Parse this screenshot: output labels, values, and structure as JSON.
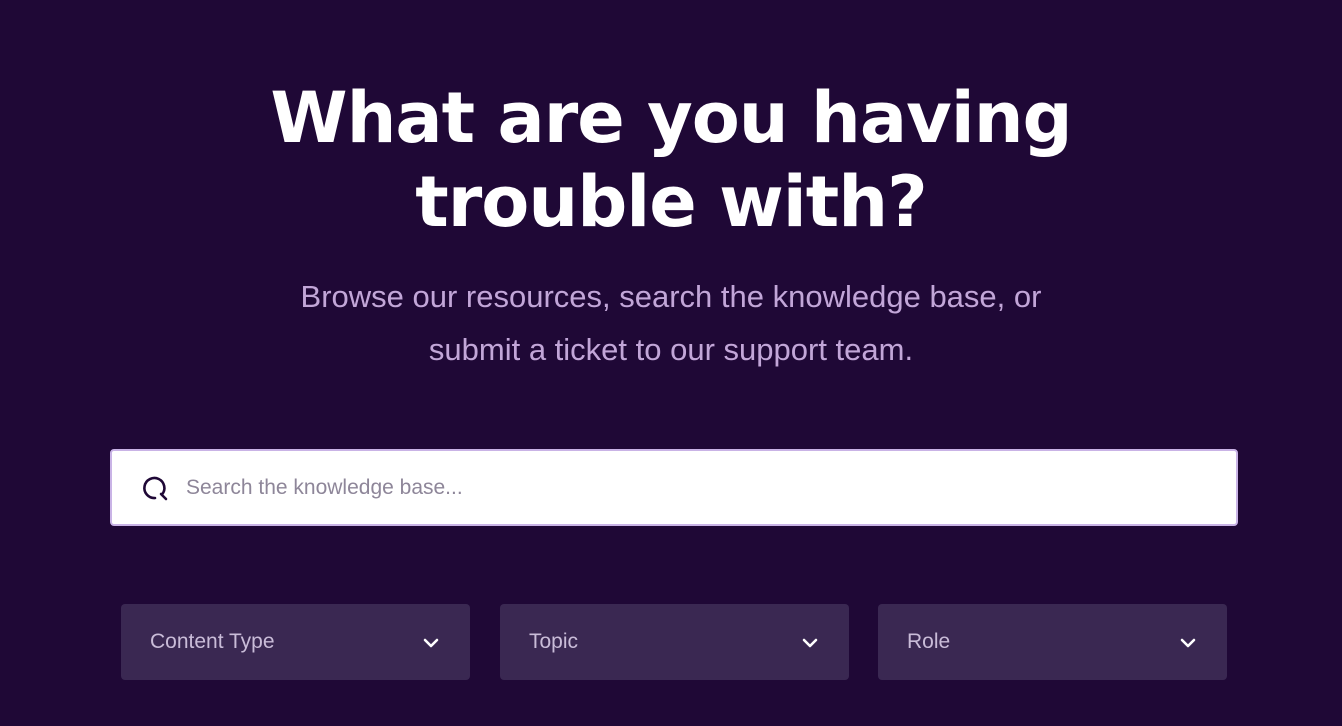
{
  "hero": {
    "title_line1": "What are you having",
    "title_line2": "trouble with?",
    "subtitle_line1": "Browse our resources, search the knowledge base, or",
    "subtitle_line2": "submit a ticket to our support team."
  },
  "search": {
    "placeholder": "Search the knowledge base...",
    "value": "",
    "icon": "search-icon"
  },
  "filters": [
    {
      "label": "Content Type",
      "icon": "chevron-down-icon"
    },
    {
      "label": "Topic",
      "icon": "chevron-down-icon"
    },
    {
      "label": "Role",
      "icon": "chevron-down-icon"
    }
  ],
  "colors": {
    "background": "#1f0836",
    "title": "#ffffff",
    "subtitle": "#c2a6d8",
    "filter_bg": "#3a2852",
    "filter_text": "#c9bcd8",
    "search_border": "#c9b3e6"
  }
}
